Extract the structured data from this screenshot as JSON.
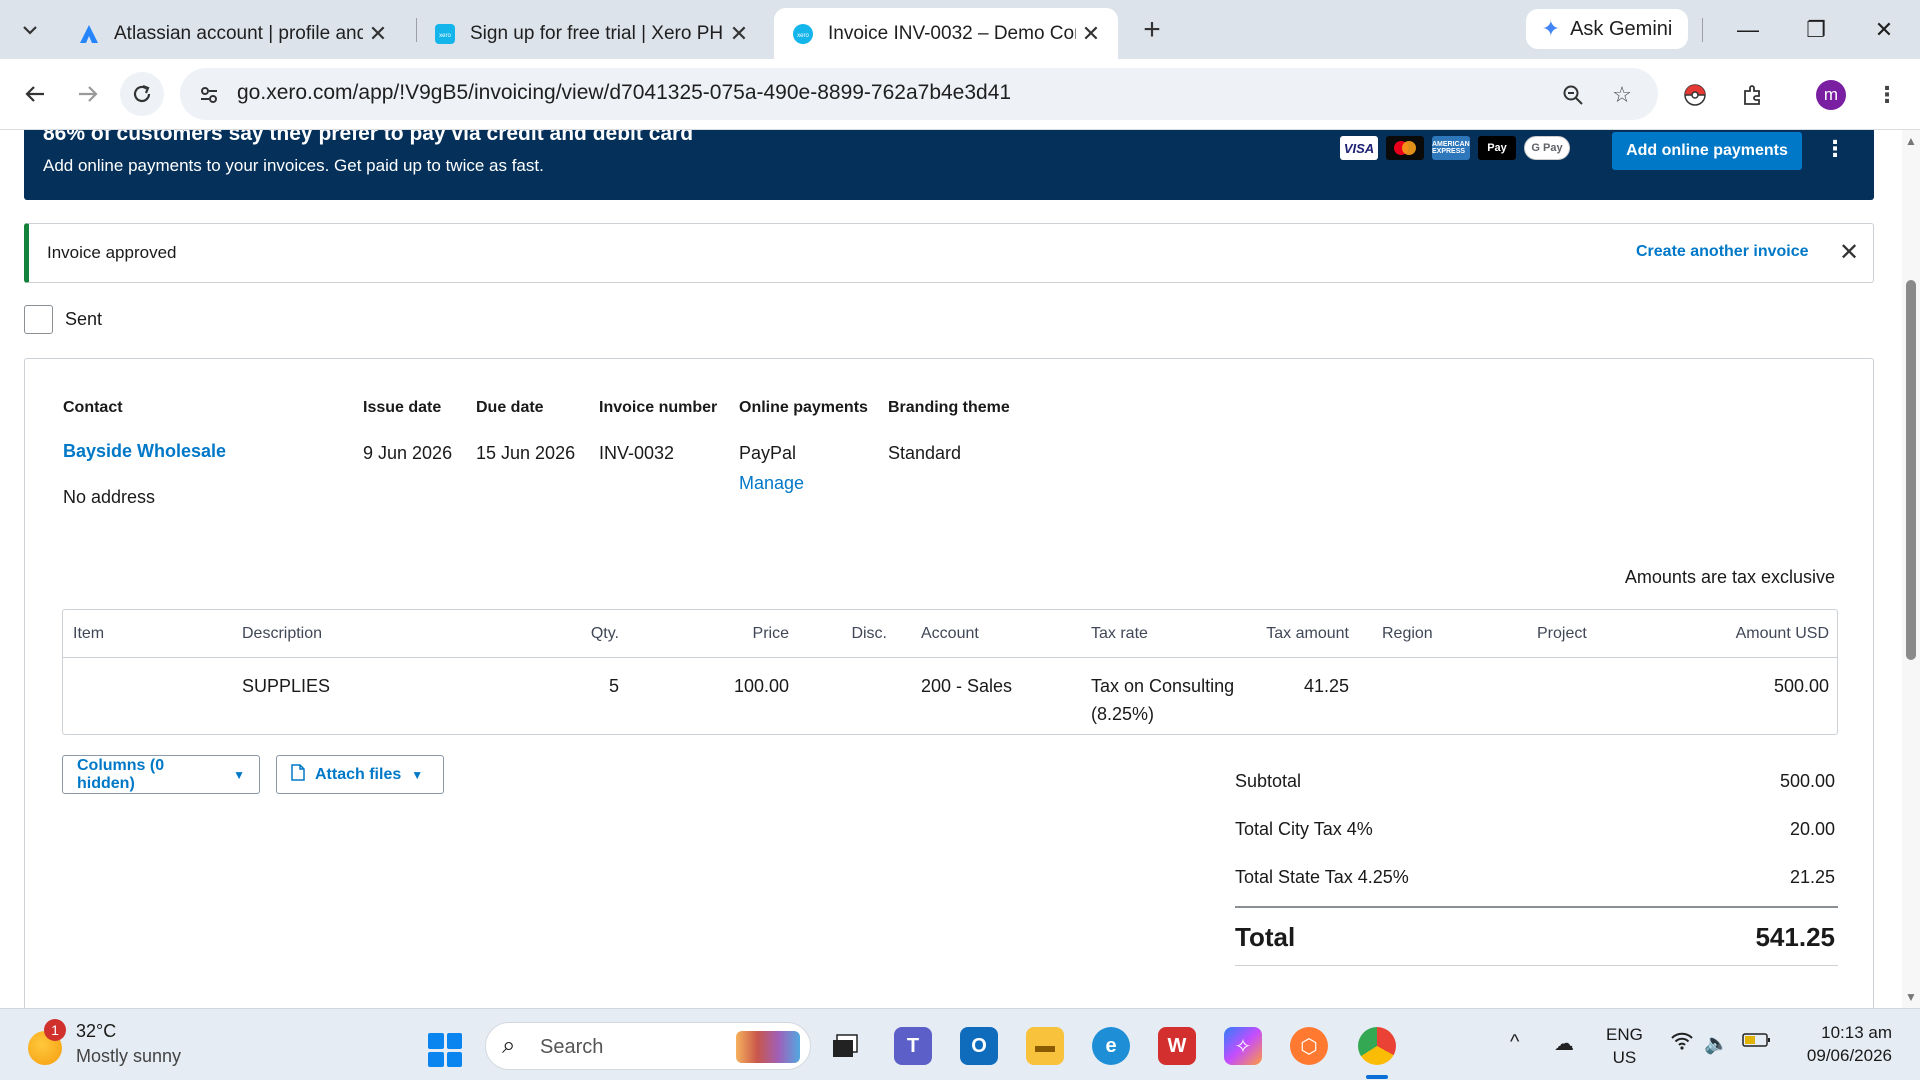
{
  "browser": {
    "tabs": [
      {
        "title": "Atlassian account | profile and v",
        "icon": "atlassian-icon"
      },
      {
        "title": "Sign up for free trial | Xero PH",
        "icon": "xero-icon"
      },
      {
        "title": "Invoice INV-0032 – Demo Comp",
        "icon": "xero-icon",
        "active": true
      }
    ],
    "gemini_label": "Ask Gemini",
    "url": "go.xero.com/app/!V9gB5/invoicing/view/d7041325-075a-490e-8899-762a7b4e3d41",
    "profile_initial": "m"
  },
  "banner": {
    "headline": "86% of customers say they prefer to pay via credit and debit card",
    "subtext": "Add online payments to your invoices. Get paid up to twice as fast.",
    "cards": [
      "VISA",
      "Mastercard",
      "AMERICAN EXPRESS",
      "Pay",
      "G Pay"
    ],
    "button": "Add online payments"
  },
  "notice": {
    "text": "Invoice approved",
    "link": "Create another invoice"
  },
  "sent_label": "Sent",
  "invoice": {
    "headers": {
      "contact": "Contact",
      "issue_date": "Issue date",
      "due_date": "Due date",
      "invoice_number": "Invoice number",
      "online_payments": "Online payments",
      "branding_theme": "Branding theme"
    },
    "contact_name": "Bayside Wholesale",
    "address": "No address",
    "issue_date": "9 Jun 2026",
    "due_date": "15 Jun 2026",
    "invoice_number": "INV-0032",
    "online_payments": "PayPal",
    "manage_link": "Manage",
    "branding_theme": "Standard",
    "tax_note": "Amounts are tax exclusive",
    "columns": [
      "Item",
      "Description",
      "Qty.",
      "Price",
      "Disc.",
      "Account",
      "Tax rate",
      "Tax amount",
      "Region",
      "Project",
      "Amount USD"
    ],
    "line": {
      "item": "",
      "description": "SUPPLIES",
      "qty": "5",
      "price": "100.00",
      "disc": "",
      "account": "200 - Sales",
      "tax_rate_1": "Tax on Consulting",
      "tax_rate_2": "(8.25%)",
      "tax_amount": "41.25",
      "region": "",
      "project": "",
      "amount": "500.00"
    },
    "columns_button": "Columns (0 hidden)",
    "attach_button": "Attach files",
    "totals": {
      "subtotal_label": "Subtotal",
      "subtotal": "500.00",
      "city_label": "Total City Tax 4%",
      "city": "20.00",
      "state_label": "Total State Tax 4.25%",
      "state": "21.25",
      "total_label": "Total",
      "total": "541.25"
    }
  },
  "taskbar": {
    "temperature": "32°C",
    "weather": "Mostly sunny",
    "weather_badge": "1",
    "search_placeholder": "Search",
    "lang_1": "ENG",
    "lang_2": "US",
    "time": "10:13 am",
    "date": "09/06/2026"
  },
  "colors": {
    "xero_blue": "#0078c8",
    "banner_navy": "#04305a",
    "approved_green": "#13823b"
  }
}
